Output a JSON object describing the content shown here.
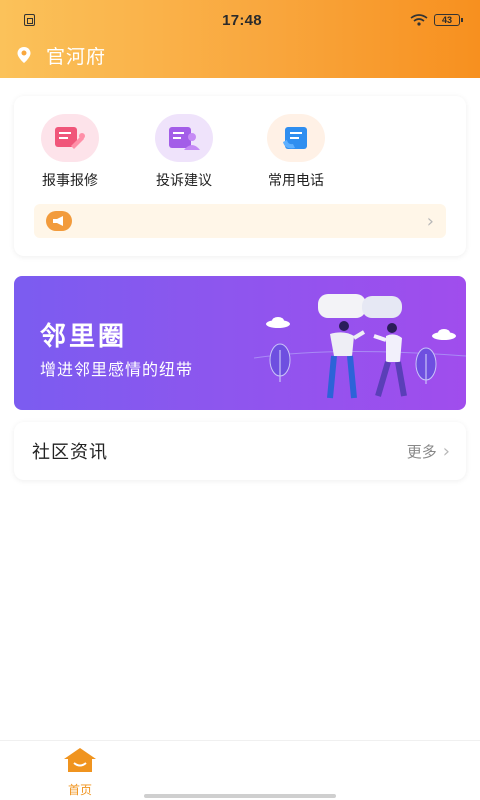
{
  "status_bar": {
    "time": "17:48",
    "battery": "43",
    "icons": [
      "sim-icon",
      "wifi-icon",
      "battery-icon"
    ]
  },
  "header": {
    "location": "官河府",
    "icon": "location-pin-icon"
  },
  "services": [
    {
      "label": "报事报修",
      "icon": "repair-icon"
    },
    {
      "label": "投诉建议",
      "icon": "complaint-icon"
    },
    {
      "label": "常用电话",
      "icon": "phone-book-icon"
    }
  ],
  "notice": {
    "text": "",
    "icon": "megaphone-icon"
  },
  "banner": {
    "title": "邻里圈",
    "subtitle": "增进邻里感情的纽带"
  },
  "news": {
    "title": "社区资讯",
    "more": "更多"
  },
  "tabbar": {
    "home_label": "首页"
  },
  "colors": {
    "accent": "#f7901f",
    "banner_purple": "#8d56ee"
  }
}
